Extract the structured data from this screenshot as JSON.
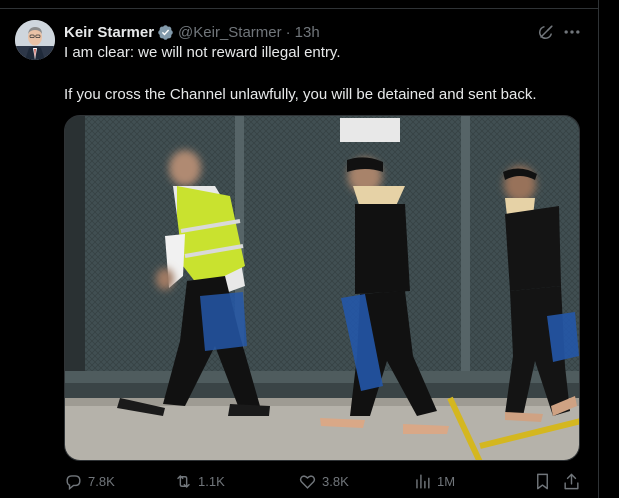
{
  "tweet": {
    "author_name": "Keir Starmer",
    "handle": "@Keir_Starmer",
    "separator": "·",
    "time": "13h",
    "line1": "I am clear: we will not reward illegal entry.",
    "line2": "If you cross the Channel unlawfully, you will be detained and sent back."
  },
  "icons": {
    "verified": "verified-badge-icon",
    "grok": "grok-icon",
    "more": "more-icon",
    "reply": "reply-icon",
    "repost": "repost-icon",
    "like": "like-icon",
    "views": "views-icon",
    "bookmark": "bookmark-icon",
    "share": "share-icon"
  },
  "actions": {
    "replies": "7.8K",
    "reposts": "1.1K",
    "likes": "3.8K",
    "views": "1M"
  },
  "colors": {
    "background": "#000000",
    "text": "#e7e9ea",
    "muted": "#71767b",
    "verified": "#829aab",
    "vest": "#c9e22f"
  }
}
